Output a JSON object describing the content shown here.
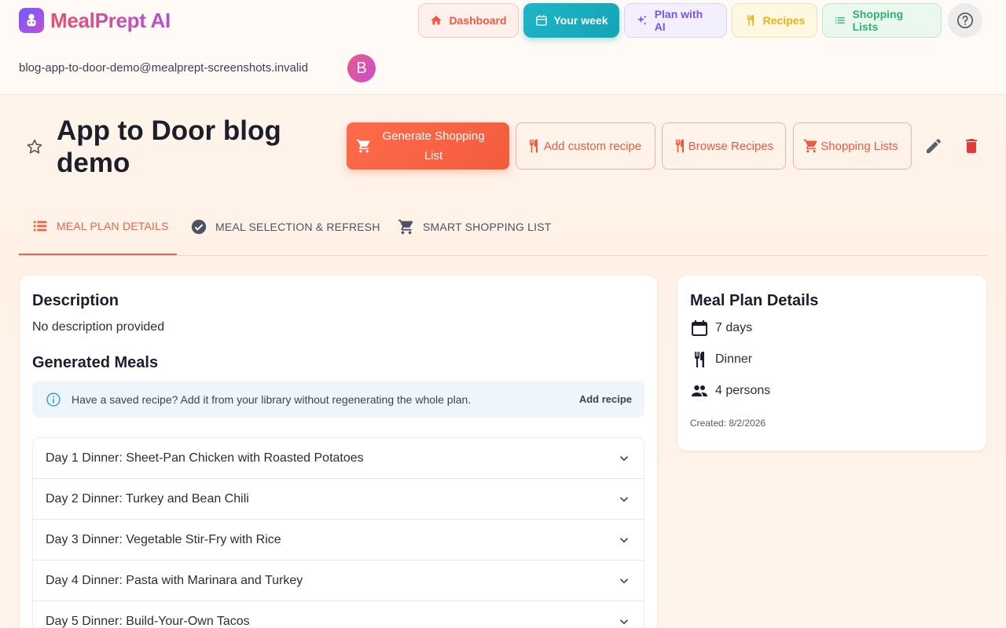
{
  "app": {
    "name": "MealPrept AI"
  },
  "nav": {
    "dashboard": "Dashboard",
    "your_week": "Your week",
    "plan_with_ai": "Plan with AI",
    "recipes": "Recipes",
    "shopping_lists": "Shopping Lists"
  },
  "user": {
    "email": "blog-app-to-door-demo@mealprept-screenshots.invalid",
    "initial": "B"
  },
  "plan": {
    "title": "App to Door blog demo"
  },
  "actions": {
    "generate": "Generate Shopping List",
    "add_custom": "Add custom recipe",
    "browse": "Browse Recipes",
    "lists": "Shopping Lists"
  },
  "tabs": [
    {
      "label": "MEAL PLAN DETAILS"
    },
    {
      "label": "MEAL SELECTION & REFRESH"
    },
    {
      "label": "SMART SHOPPING LIST"
    }
  ],
  "main": {
    "description_heading": "Description",
    "description_text": "No description provided",
    "meals_heading": "Generated Meals",
    "info_text": "Have a saved recipe? Add it from your library without regenerating the whole plan.",
    "add_recipe": "Add recipe",
    "meals": [
      "Day 1 Dinner: Sheet-Pan Chicken with Roasted Potatoes",
      "Day 2 Dinner: Turkey and Bean Chili",
      "Day 3 Dinner: Vegetable Stir-Fry with Rice",
      "Day 4 Dinner: Pasta with Marinara and Turkey",
      "Day 5 Dinner: Build-Your-Own Tacos"
    ]
  },
  "side": {
    "heading": "Meal Plan Details",
    "days": "7 days",
    "meal_type": "Dinner",
    "persons": "4 persons",
    "created": "Created: 8/2/2026"
  },
  "colors": {
    "accent": "#f0624a",
    "teal": "#12a4b7"
  }
}
